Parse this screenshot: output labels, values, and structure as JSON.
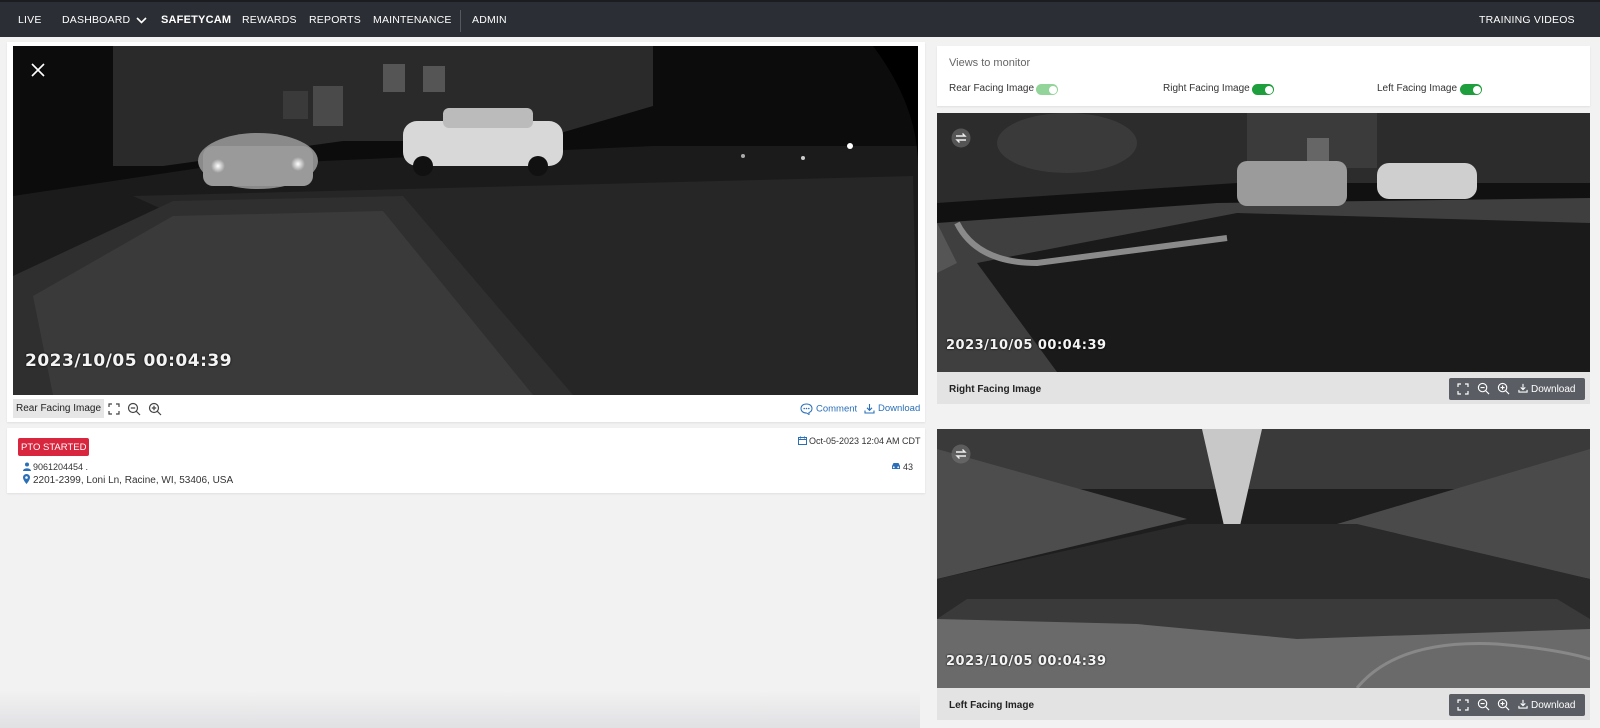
{
  "nav": {
    "items": [
      "LIVE",
      "DASHBOARD",
      "SAFETYCAM",
      "REWARDS",
      "REPORTS",
      "MAINTENANCE",
      "ADMIN"
    ],
    "active": "SAFETYCAM",
    "right_link": "TRAINING VIDEOS"
  },
  "main_view": {
    "timestamp": "2023/10/05  00:04:39",
    "label": "Rear Facing Image",
    "comment_label": "Comment",
    "download_label": "Download"
  },
  "event": {
    "badge": "PTO STARTED",
    "date": "Oct-05-2023 12:04 AM CDT",
    "driver_id": "9061204454 .",
    "vehicle": "43",
    "address": "2201-2399, Loni Ln, Racine, WI, 53406, USA"
  },
  "monitor": {
    "title": "Views to monitor",
    "toggles": [
      {
        "label": "Rear Facing Image",
        "on": true,
        "color": "#93d49a"
      },
      {
        "label": "Right Facing Image",
        "on": true,
        "color": "#1e9e3c"
      },
      {
        "label": "Left Facing Image",
        "on": true,
        "color": "#1e9e3c"
      }
    ]
  },
  "cameras": [
    {
      "title": "Right Facing Image",
      "timestamp": "2023/10/05  00:04:39",
      "download_label": "Download"
    },
    {
      "title": "Left Facing Image",
      "timestamp": "2023/10/05  00:04:39",
      "download_label": "Download"
    }
  ],
  "colors": {
    "nav_bg": "#2b2e34",
    "accent_link": "#2a6fb8",
    "badge_red": "#d7263d",
    "toggle_on": "#1e9e3c"
  }
}
